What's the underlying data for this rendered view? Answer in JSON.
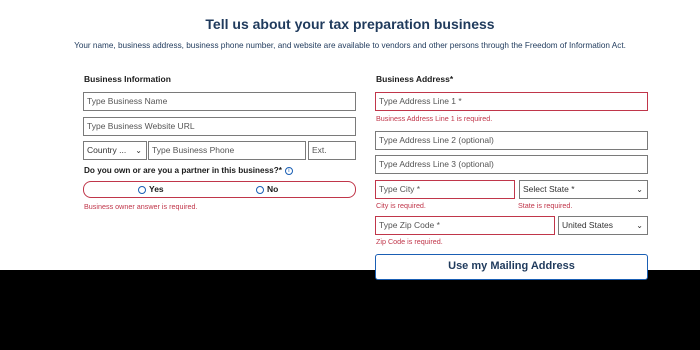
{
  "header": {
    "title": "Tell us about your tax preparation business",
    "subtitle": "Your name, business address, business phone number, and website are available to vendors and other persons through the Freedom of Information Act."
  },
  "business_info": {
    "label": "Business Information",
    "name_placeholder": "Type Business Name",
    "website_placeholder": "Type Business Website URL",
    "country_select": "Country ...",
    "phone_placeholder": "Type Business Phone",
    "ext_placeholder": "Ext.",
    "partner_question": "Do you own or are you a partner in this business?*",
    "yes_label": "Yes",
    "no_label": "No",
    "partner_error": "Business owner answer is required."
  },
  "business_address": {
    "label": "Business Address*",
    "line1_placeholder": "Type Address Line 1 *",
    "line1_error": "Business Address Line 1 is required.",
    "line2_placeholder": "Type Address Line 2 (optional)",
    "line3_placeholder": "Type Address Line 3 (optional)",
    "city_placeholder": "Type City *",
    "city_error": "City is required.",
    "state_select": "Select State *",
    "state_error": "State is required.",
    "zip_placeholder": "Type Zip Code *",
    "zip_error": "Zip Code is required.",
    "country_select": "United States",
    "mailing_button": "Use my Mailing Address"
  },
  "colors": {
    "primary": "#1a5fb4",
    "error": "#c0364a",
    "heading": "#1f3a5c"
  }
}
